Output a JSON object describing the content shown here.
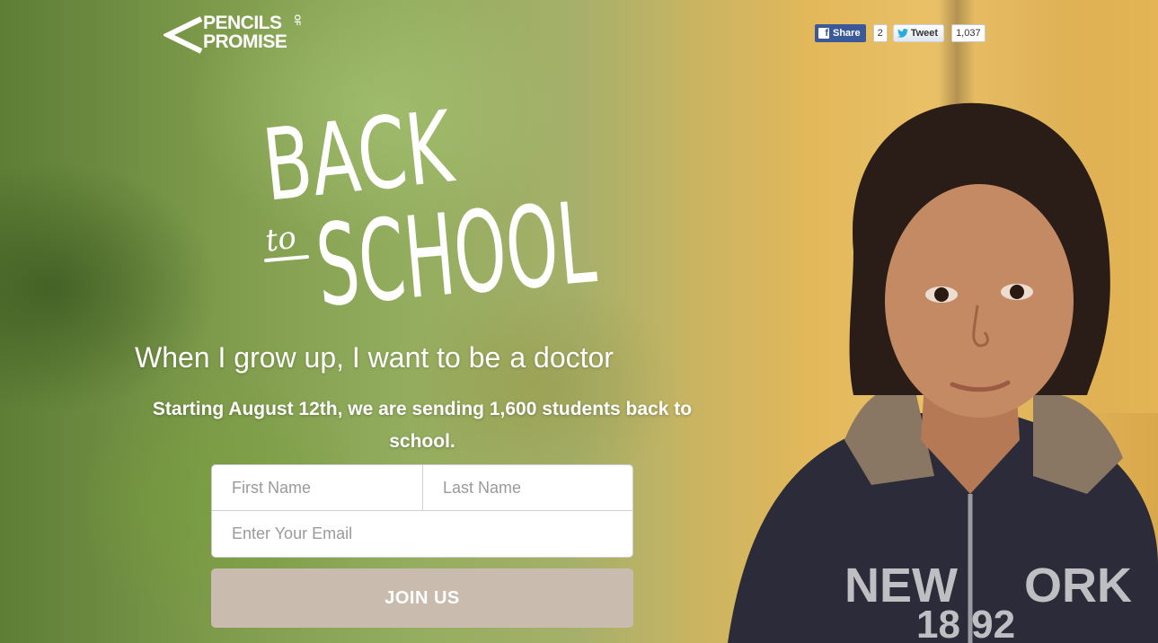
{
  "logo": {
    "line1": "PENCILS",
    "of": "OF",
    "line2": "PROMISE"
  },
  "social": {
    "share_label": "Share",
    "share_count": "2",
    "tweet_label": "Tweet",
    "tweet_count": "1,037"
  },
  "title": {
    "back": "BACK",
    "to": "to",
    "school": "SCHOOL"
  },
  "headline": {
    "prefix": "When I grow up, I want to be",
    "role": "a doctor"
  },
  "subtext": "Starting August 12th, we are sending 1,600 students back to school.",
  "form": {
    "first_name_placeholder": "First Name",
    "last_name_placeholder": "Last Name",
    "email_placeholder": "Enter Your Email",
    "submit_label": "JOIN US"
  }
}
